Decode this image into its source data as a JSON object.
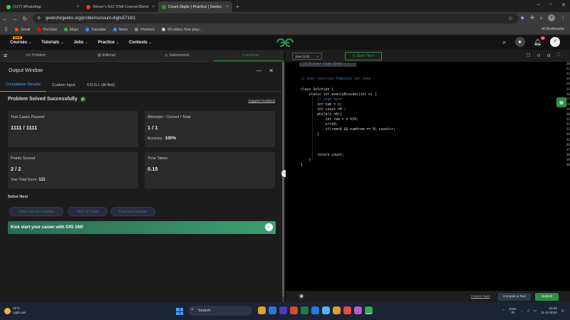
{
  "browser": {
    "tabs": [
      {
        "title": "(127) WhatsApp",
        "color": "#25d366",
        "active": false
      },
      {
        "title": "Striver's A2Z DSA Course/Sheet",
        "color": "#e53935",
        "active": false
      },
      {
        "title": "Count Digits | Practice | Geeks",
        "color": "#2f8d46",
        "active": true
      }
    ],
    "new_tab": "+",
    "url": "geeksforgeeks.org/problems/count-digits5716/1",
    "profile_initial": "Y",
    "bookmarks": [
      {
        "label": "Gmail",
        "color": "#ea4335"
      },
      {
        "label": "YouTube",
        "color": "#ff0000"
      },
      {
        "label": "Maps",
        "color": "#34a853"
      },
      {
        "label": "Translate",
        "color": "#4285f4"
      },
      {
        "label": "News",
        "color": "#4285f4"
      },
      {
        "label": "Premium",
        "color": "#888888"
      },
      {
        "label": "69 videos Now playi...",
        "color": "#cccccc"
      }
    ],
    "all_bookmarks": "All Bookmarks"
  },
  "gfg": {
    "sale_badge": "SALE",
    "menu": [
      "Courses",
      "Tutorials",
      "Jobs",
      "Practice",
      "Contests"
    ],
    "logo": "GfG",
    "notif_count": "42",
    "user_initial": "Y",
    "accent": "#2f8d46"
  },
  "problem_tabs": [
    "Problem",
    "Editorial",
    "Submissions",
    "Comments"
  ],
  "output": {
    "title": "Output Window",
    "tabs": [
      "Compilation Results",
      "Custom Input",
      "Y.O.G.I. (AI Bot)"
    ],
    "status": "Problem Solved Successfully",
    "feedback": "Suggest Feedback",
    "cards": {
      "test_cases_label": "Test Cases Passed",
      "test_cases_value": "1111 / 1111",
      "attempts_label": "Attempts : Correct / Total",
      "attempts_value": "1 / 1",
      "accuracy_label": "Accuracy :",
      "accuracy_value": "100%",
      "points_label": "Points Scored",
      "points_value": "2 / 2",
      "total_score_label": "Your Total Score:",
      "total_score_value": "111",
      "time_label": "Time Taken",
      "time_value": "0.15"
    },
    "solve_next_title": "Solve Next",
    "solve_next": [
      "Cube root of a number",
      "Sum Of Digits",
      "Disarium Number"
    ],
    "banner": "Kick start your career with GfG 160!"
  },
  "editor": {
    "language": "Java (1.8)",
    "timer_label": "Start Timer",
    "lines": [
      {
        "n": "20",
        "t": "//{ Driver Code Ends",
        "c": true
      },
      {
        "n": "21",
        "t": "",
        "c": false
      },
      {
        "n": "22",
        "t": "",
        "c": false
      },
      {
        "n": "23",
        "t": "// User function Template for Java",
        "c": true
      },
      {
        "n": "24",
        "t": "",
        "c": false
      },
      {
        "n": "25",
        "t": "class Solution {",
        "c": false
      },
      {
        "n": "26",
        "t": "    static int evenlyDivides(int n) {",
        "c": false
      },
      {
        "n": "27",
        "t": "        // code here",
        "c": true
      },
      {
        "n": "28",
        "t": "        int num = n;",
        "c": false
      },
      {
        "n": "29",
        "t": "        int count =0 ;",
        "c": false
      },
      {
        "n": "30",
        "t": "        while(n >0){",
        "c": false
      },
      {
        "n": "31",
        "t": "            int rem = n %10;",
        "c": false
      },
      {
        "n": "32",
        "t": "            n/=10;",
        "c": false
      },
      {
        "n": "33",
        "t": "            if(rem>0 && num%rem == 0) count++;",
        "c": false
      },
      {
        "n": "34",
        "t": "        }",
        "c": false
      },
      {
        "n": "35",
        "t": "",
        "c": false
      },
      {
        "n": "36",
        "t": "",
        "c": false
      },
      {
        "n": "37",
        "t": "",
        "c": false
      },
      {
        "n": "38",
        "t": "        return count;",
        "c": false
      },
      {
        "n": "39",
        "t": "    }",
        "c": false
      },
      {
        "n": "40",
        "t": "}",
        "c": false
      }
    ],
    "custom_input": "Custom Input",
    "compile_run": "Compile & Run",
    "submit": "Submit"
  },
  "taskbar": {
    "temp": "25°C",
    "weather": "Light rain",
    "search": "Search",
    "lang1": "ENG",
    "lang2": "IN",
    "time": "23:39",
    "date": "11-12-2024",
    "app_colors": [
      "#e0a02a",
      "#2b78e4",
      "#4a3ec4",
      "#d44e2c",
      "#1a7f3c",
      "#2b78e4",
      "#5ab1f0",
      "#e0a02a",
      "#e74c3c",
      "#b55ad6",
      "#34a853"
    ]
  }
}
